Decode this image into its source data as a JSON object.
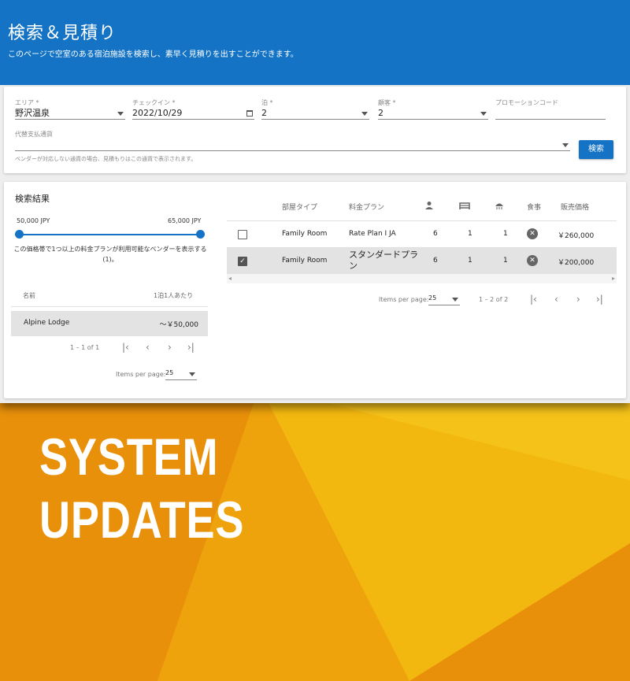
{
  "header": {
    "title": "検索＆見積り",
    "subtitle": "このページで空室のある宿泊施設を検索し、素早く見積りを出すことができます。"
  },
  "search": {
    "area_label": "エリア *",
    "area_value": "野沢温泉",
    "checkin_label": "チェックイン *",
    "checkin_value": "2022/10/29",
    "nights_label": "泊 *",
    "nights_value": "2",
    "guests_label": "顧客 *",
    "guests_value": "2",
    "promo_label": "プロモーションコード",
    "promo_value": "",
    "currency_label": "代替支払通貨",
    "currency_value": "",
    "currency_hint": "ベンダーが対応しない通貨の場合、見積もりはこの通貨で表示されます。",
    "search_button": "検索"
  },
  "results": {
    "title": "検索結果",
    "price_min": "50,000 JPY",
    "price_max": "65,000 JPY",
    "price_min_fraction": 0.0,
    "price_max_fraction": 1.0,
    "range_note": "この価格帯で1つ以上の料金プランが利用可能なベンダーを表示する(1)。",
    "list_header_name": "名前",
    "list_header_price": "1泊1人あたり",
    "vendors": [
      {
        "name": "Alpine Lodge",
        "price": "～￥50,000"
      }
    ],
    "list_pagination": "1 – 1 of 1",
    "list_items_label": "Items per page:",
    "list_items_value": "25"
  },
  "rates": {
    "col_room_type": "部屋タイプ",
    "col_plan": "料金プラン",
    "col_meal": "食事",
    "col_price": "販売価格",
    "icons": [
      "person-icon",
      "bed-icon",
      "bath-icon"
    ],
    "rows": [
      {
        "checked": false,
        "room": "Family Room",
        "plan": "Rate Plan I JA",
        "guests": "6",
        "beds": "1",
        "baths": "1",
        "price": "￥260,000"
      },
      {
        "checked": true,
        "room": "Family Room",
        "plan": "スタンダードプラン",
        "guests": "6",
        "beds": "1",
        "baths": "1",
        "price": "￥200,000"
      }
    ],
    "items_label": "Items per page:",
    "items_value": "25",
    "pagination": "1 – 2 of 2"
  },
  "banner": {
    "line1": "SYSTEM",
    "line2": "UPDATES"
  },
  "colors": {
    "primary": "#1473c4",
    "banner_orange": "#e8900a",
    "banner_yellow": "#f3b80f"
  }
}
